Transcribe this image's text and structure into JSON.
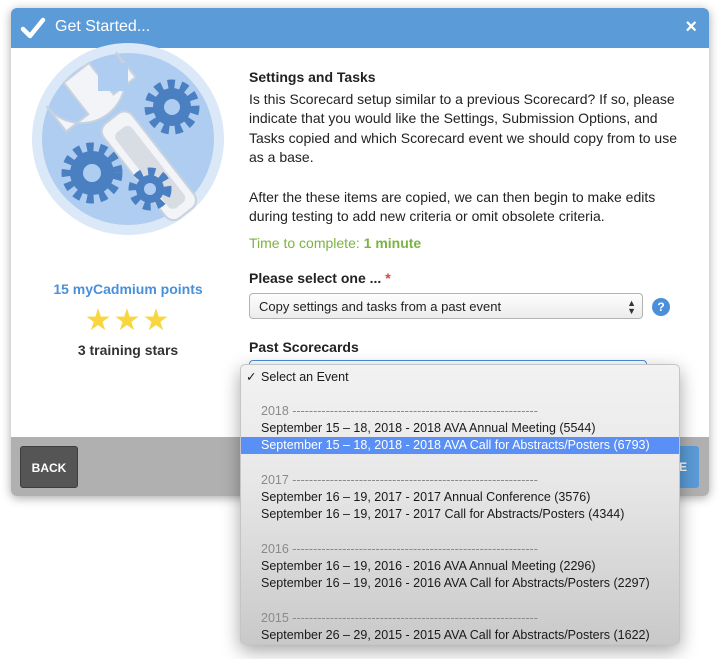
{
  "header": {
    "title": "Get Started...",
    "close_label": "×"
  },
  "badge": {
    "points_text": "15 myCadmium points",
    "stars": "★★★",
    "star_count": 3,
    "stars_label": "3 training stars"
  },
  "content": {
    "heading": "Settings and Tasks",
    "paragraph1": "Is this Scorecard setup similar to a previous Scorecard? If so, please indicate that you would like the Settings, Submission Options, and Tasks copied and which Scorecard event we should copy from to use as a base.",
    "paragraph2": "After the these items are copied, we can then begin to make edits during testing to add new criteria or omit obsolete criteria.",
    "time_label": "Time to complete:",
    "time_value": "1 minute"
  },
  "form": {
    "select_label": "Please select one ...",
    "required_mark": "*",
    "select_value": "Copy settings and tasks from a past event",
    "help_label": "?",
    "past_label": "Past Scorecards"
  },
  "footer": {
    "back_label": "BACK",
    "next_label": "E"
  },
  "dropdown": {
    "check_mark": "✓",
    "options": [
      {
        "label": "Select an Event",
        "kind": "option",
        "selected": true
      },
      {
        "label": "",
        "kind": "spacer"
      },
      {
        "label": "2018 -----------------------------------------------------------",
        "kind": "group"
      },
      {
        "label": "September 15 – 18, 2018 - 2018 AVA Annual Meeting (5544)",
        "kind": "option"
      },
      {
        "label": "September 15 – 18, 2018 - 2018 AVA Call for Abstracts/Posters (6793)",
        "kind": "option",
        "highlighted": true
      },
      {
        "label": "",
        "kind": "spacer"
      },
      {
        "label": "2017 -----------------------------------------------------------",
        "kind": "group"
      },
      {
        "label": "September 16 – 19, 2017 - 2017 Annual Conference (3576)",
        "kind": "option"
      },
      {
        "label": "September 16 – 19, 2017 - 2017 Call for Abstracts/Posters (4344)",
        "kind": "option"
      },
      {
        "label": "",
        "kind": "spacer"
      },
      {
        "label": "",
        "kind": "spacer"
      },
      {
        "label": "2016 -----------------------------------------------------------",
        "kind": "group"
      },
      {
        "label": "September 16 – 19, 2016 - 2016 AVA Annual Meeting (2296)",
        "kind": "option"
      },
      {
        "label": "September 16 – 19, 2016 - 2016 AVA Call for Abstracts/Posters (2297)",
        "kind": "option"
      },
      {
        "label": "",
        "kind": "spacer"
      },
      {
        "label": "",
        "kind": "spacer"
      },
      {
        "label": "2015 -----------------------------------------------------------",
        "kind": "group"
      },
      {
        "label": "September 26 – 29, 2015 - 2015 AVA Call for Abstracts/Posters (1622)",
        "kind": "option"
      }
    ]
  },
  "colors": {
    "accent": "#5b9bd8",
    "link_blue": "#4a90d9",
    "star_yellow": "#f7d640",
    "time_green": "#7cb342",
    "required_red": "#d9433a",
    "highlight": "#5a8ff5"
  },
  "icons": {
    "header": "checkmark-icon",
    "badge": "wrench-gears-icon",
    "help": "question-icon"
  }
}
